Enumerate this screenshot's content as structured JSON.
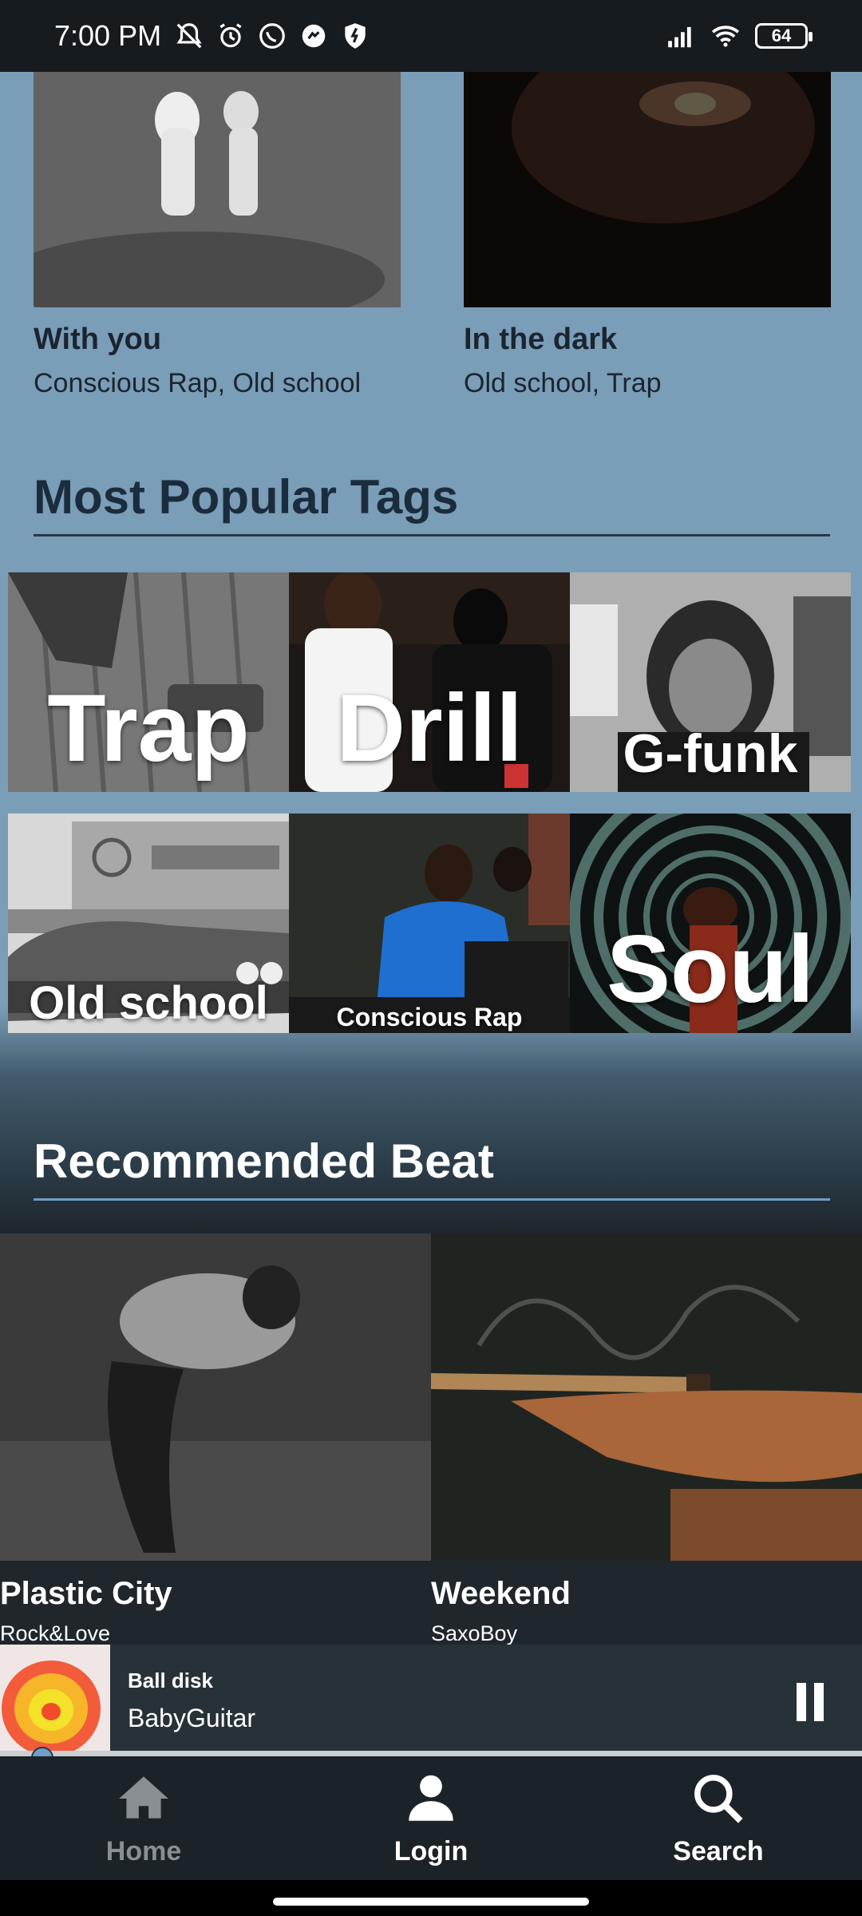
{
  "status_bar": {
    "time": "7:00 PM",
    "battery": "64"
  },
  "top_cards": [
    {
      "title": "With you",
      "tags": "Conscious Rap, Old school"
    },
    {
      "title": "In the dark",
      "tags": "Old school, Trap"
    }
  ],
  "popular_tags": {
    "heading": "Most Popular Tags",
    "items": [
      "Trap",
      "Drill",
      "G-funk",
      "Old school",
      "Conscious Rap",
      "Soul"
    ]
  },
  "recommended": {
    "heading": "Recommended Beat",
    "items": [
      {
        "title": "Plastic City",
        "artist": "Rock&Love"
      },
      {
        "title": "Weekend",
        "artist": "SaxoBoy"
      }
    ]
  },
  "player": {
    "title": "Ball disk",
    "artist": "BabyGuitar",
    "progress": 0.03
  },
  "nav": {
    "home": "Home",
    "login": "Login",
    "search": "Search"
  },
  "colors": {
    "accent": "#6f9ec7",
    "background_top": "#7a9db8",
    "background_dark": "#1f272d"
  }
}
